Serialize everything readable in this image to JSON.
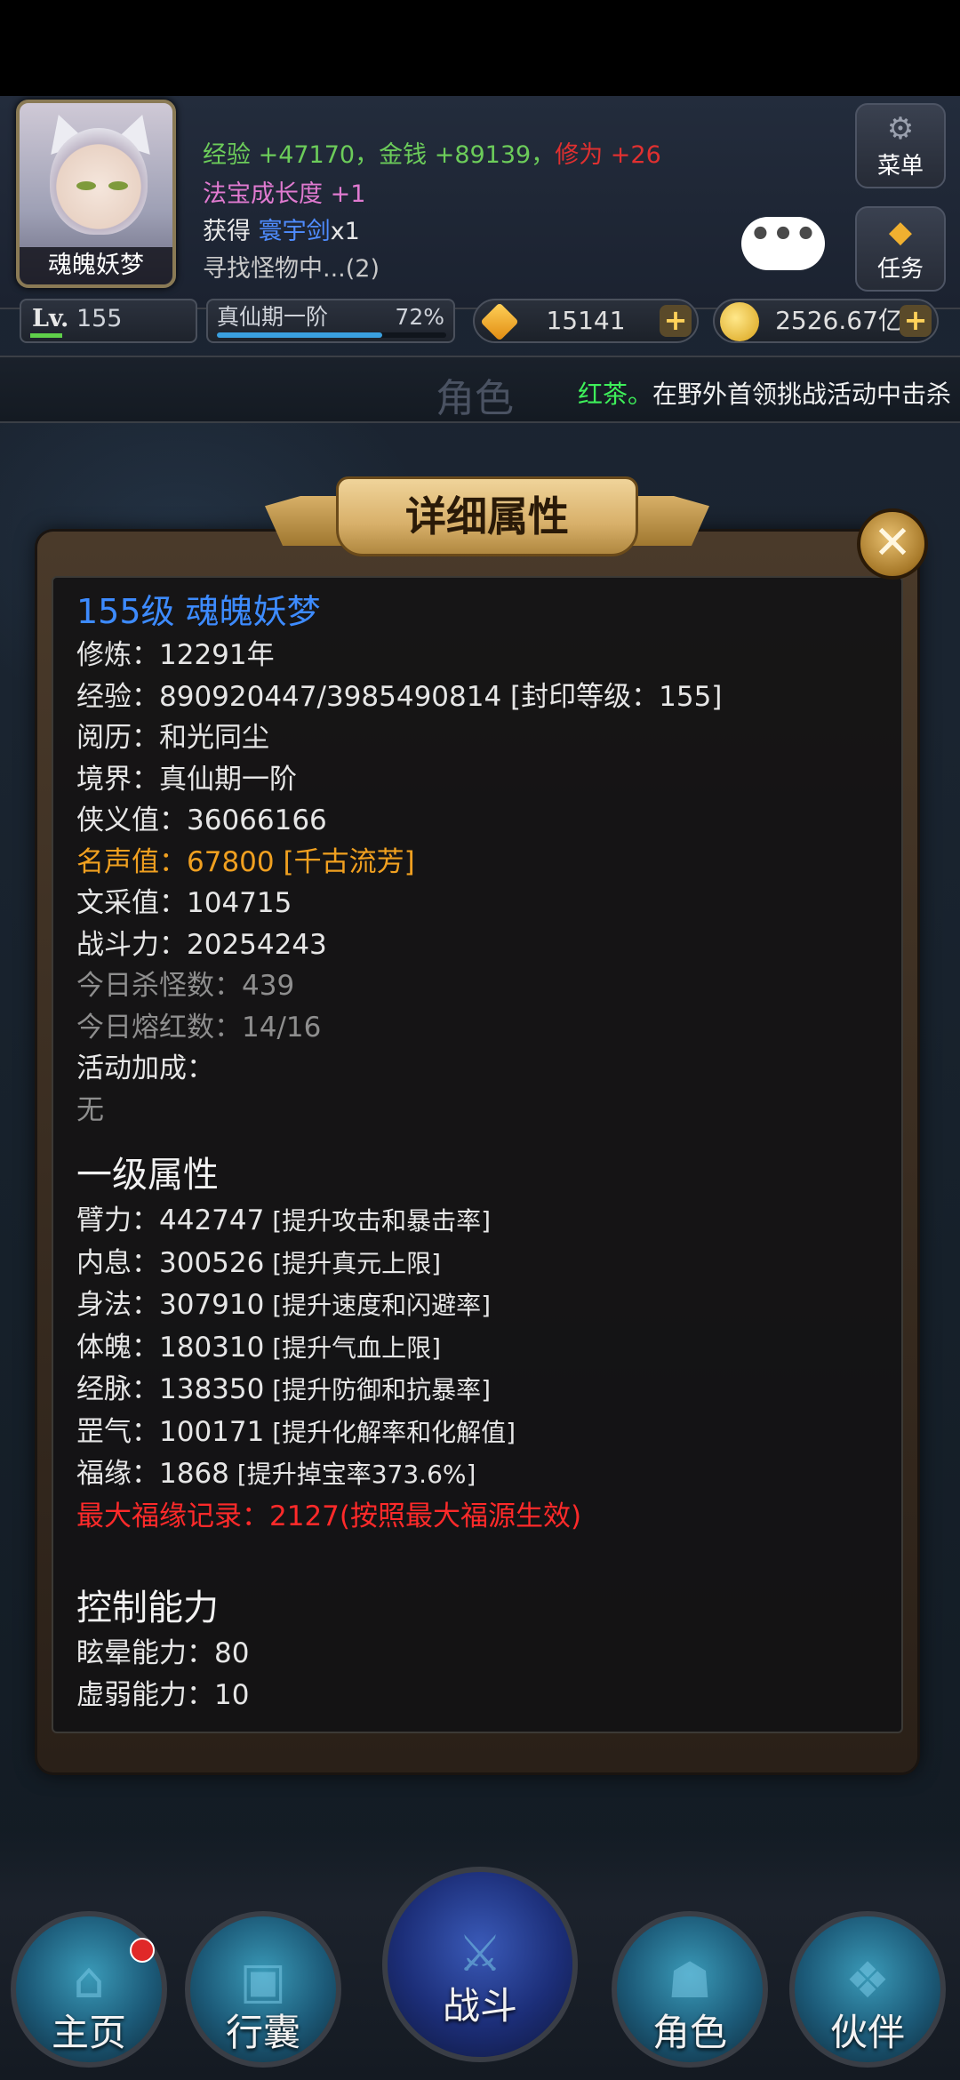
{
  "player": {
    "name": "魂魄妖梦",
    "level_label": "Lv.",
    "level": "155",
    "level_progress": 0.2,
    "realm": "真仙期一阶",
    "realm_percent": "72%",
    "realm_progress": 0.72
  },
  "log": {
    "exp": "经验 +47170，",
    "money": "金钱 +89139，",
    "cultivation": "修为 +26",
    "treasure_growth": "法宝成长度 +1",
    "obtain_prefix": "获得 ",
    "obtain_item": "寰宇剑",
    "obtain_count": "x1",
    "status": "寻找怪物中...(2)"
  },
  "side_buttons": {
    "menu": "菜单",
    "task": "任务",
    "menu_icon": "gear-icon",
    "task_icon": "gem-icon"
  },
  "chat_bubble": "•••",
  "currency": {
    "gems": "15141",
    "gold": "2526.67亿",
    "plus": "+"
  },
  "ticker": {
    "section_title": "角色",
    "name": "红茶。",
    "message": "在野外首领挑战活动中击杀"
  },
  "panel": {
    "title": "详细属性",
    "close": "✕",
    "header": "155级 魂魄妖梦",
    "basic": [
      "修炼：12291年",
      "经验：890920447/3985490814 [封印等级：155]",
      "阅历：和光同尘",
      "境界：真仙期一阶",
      "侠义值：36066166"
    ],
    "fame": "名声值：67800 [千古流芳]",
    "basic2": [
      "文采值：104715",
      "战斗力：20254243"
    ],
    "daily": [
      "今日杀怪数：439",
      "今日熔红数：14/16"
    ],
    "bonus_label": "活动加成：",
    "bonus_value": "无",
    "primary_title": "一级属性",
    "primary": [
      {
        "main": "臂力：442747",
        "note": " [提升攻击和暴击率]"
      },
      {
        "main": "内息：300526",
        "note": " [提升真元上限]"
      },
      {
        "main": "身法：307910",
        "note": " [提升速度和闪避率]"
      },
      {
        "main": "体魄：180310",
        "note": " [提升气血上限]"
      },
      {
        "main": "经脉：138350",
        "note": " [提升防御和抗暴率]"
      },
      {
        "main": "罡气：100171",
        "note": " [提升化解率和化解值]"
      },
      {
        "main": "福缘：1868",
        "note": " [提升掉宝率373.6%]"
      }
    ],
    "max_luck": "最大福缘记录：2127(按照最大福源生效)",
    "control_title": "控制能力",
    "control": [
      "眩晕能力：80",
      "虚弱能力：10"
    ]
  },
  "bottom_nav": [
    {
      "label": "主页",
      "icon": "home-icon",
      "badge": true
    },
    {
      "label": "行囊",
      "icon": "bag-icon",
      "badge": false
    },
    {
      "label": "战斗",
      "icon": "sword-icon",
      "badge": false
    },
    {
      "label": "角色",
      "icon": "character-icon",
      "badge": false
    },
    {
      "label": "伙伴",
      "icon": "partner-icon",
      "badge": false
    }
  ],
  "colors": {
    "header_blue": "#3d8bff",
    "fame_orange": "#f0a020",
    "highlight_red": "#ff2a2a",
    "log_green": "#6ccc5a",
    "log_pink": "#e07ad0"
  }
}
